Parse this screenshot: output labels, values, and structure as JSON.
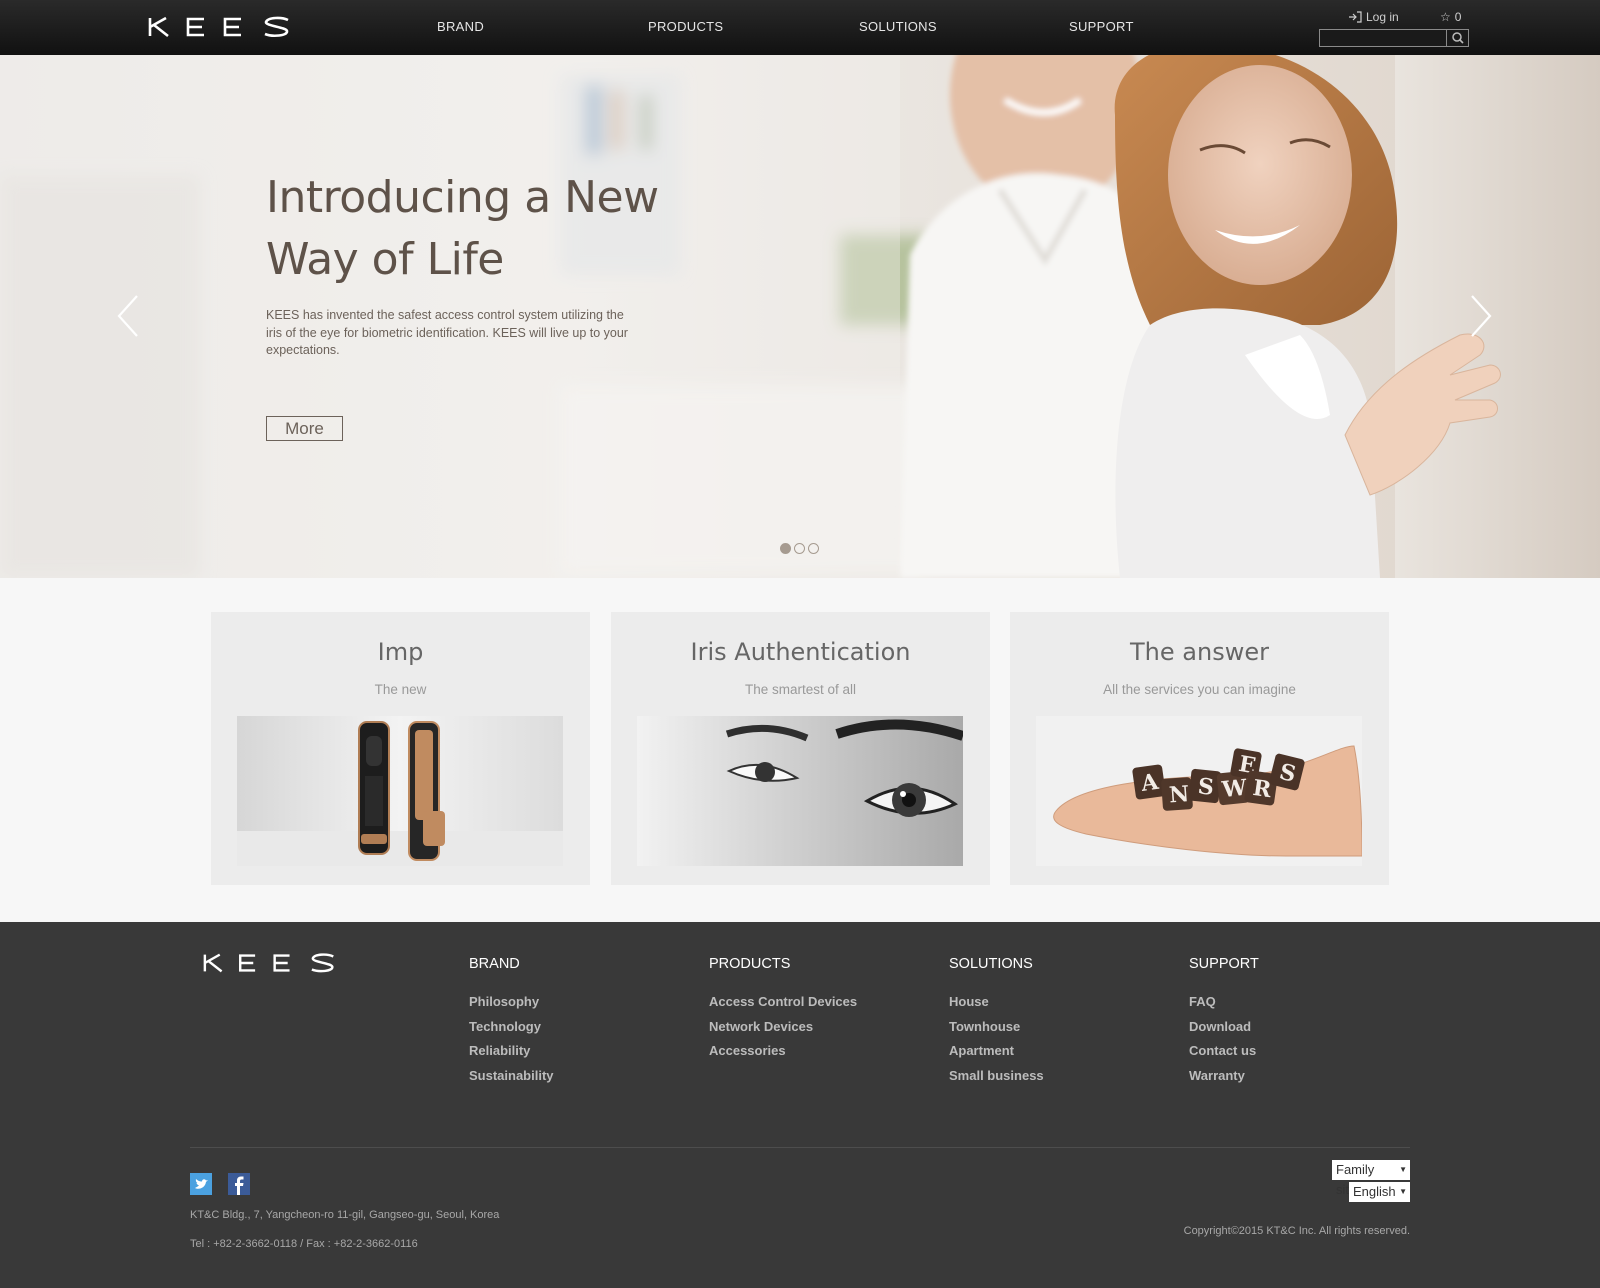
{
  "header": {
    "logo_text": "KEES",
    "nav": [
      "BRAND",
      "PRODUCTS",
      "SOLUTIONS",
      "SUPPORT"
    ],
    "login_label": "Log in",
    "favorites_count": "0",
    "search_placeholder": ""
  },
  "hero": {
    "title_line1": "Introducing a New",
    "title_line2": "Way of Life",
    "text": "KEES has invented the safest access control system utilizing the iris of the eye for biometric identification. KEES will live up to your expectations.",
    "more_label": "More",
    "slide_count": 3,
    "active_slide": 1
  },
  "cards": [
    {
      "title": "Imp",
      "subtitle": "The new",
      "image": "door-lock-product-photo"
    },
    {
      "title": "Iris Authentication",
      "subtitle": "The smartest of all",
      "image": "eye-close-up-photo"
    },
    {
      "title": "The answer",
      "subtitle": "All the services you can imagine",
      "image": "hand-holding-answers-blocks-photo"
    }
  ],
  "footer": {
    "columns": [
      {
        "heading": "BRAND",
        "links": [
          "Philosophy",
          "Technology",
          "Reliability",
          "Sustainability"
        ]
      },
      {
        "heading": "PRODUCTS",
        "links": [
          "Access Control Devices",
          "Network Devices",
          "Accessories"
        ]
      },
      {
        "heading": "SOLUTIONS",
        "links": [
          "House",
          "Townhouse",
          "Apartment",
          "Small business"
        ]
      },
      {
        "heading": "SUPPORT",
        "links": [
          "FAQ",
          "Download",
          "Contact us",
          "Warranty"
        ]
      }
    ],
    "address": "KT&C Bldg., 7, Yangcheon-ro 11-gil, Gangseo-gu, Seoul, Korea",
    "tel": "Tel : +82-2-3662-0118 / Fax : +82-2-3662-0116",
    "family_site": "Family site",
    "language": "English",
    "copyright": "Copyright©2015 KT&C Inc. All rights reserved."
  },
  "colors": {
    "header_bg": "#1a1a1a",
    "footer_bg": "#393939",
    "hero_text": "#5e5249",
    "twitter": "#4ba1e0",
    "facebook": "#3b5b98"
  }
}
